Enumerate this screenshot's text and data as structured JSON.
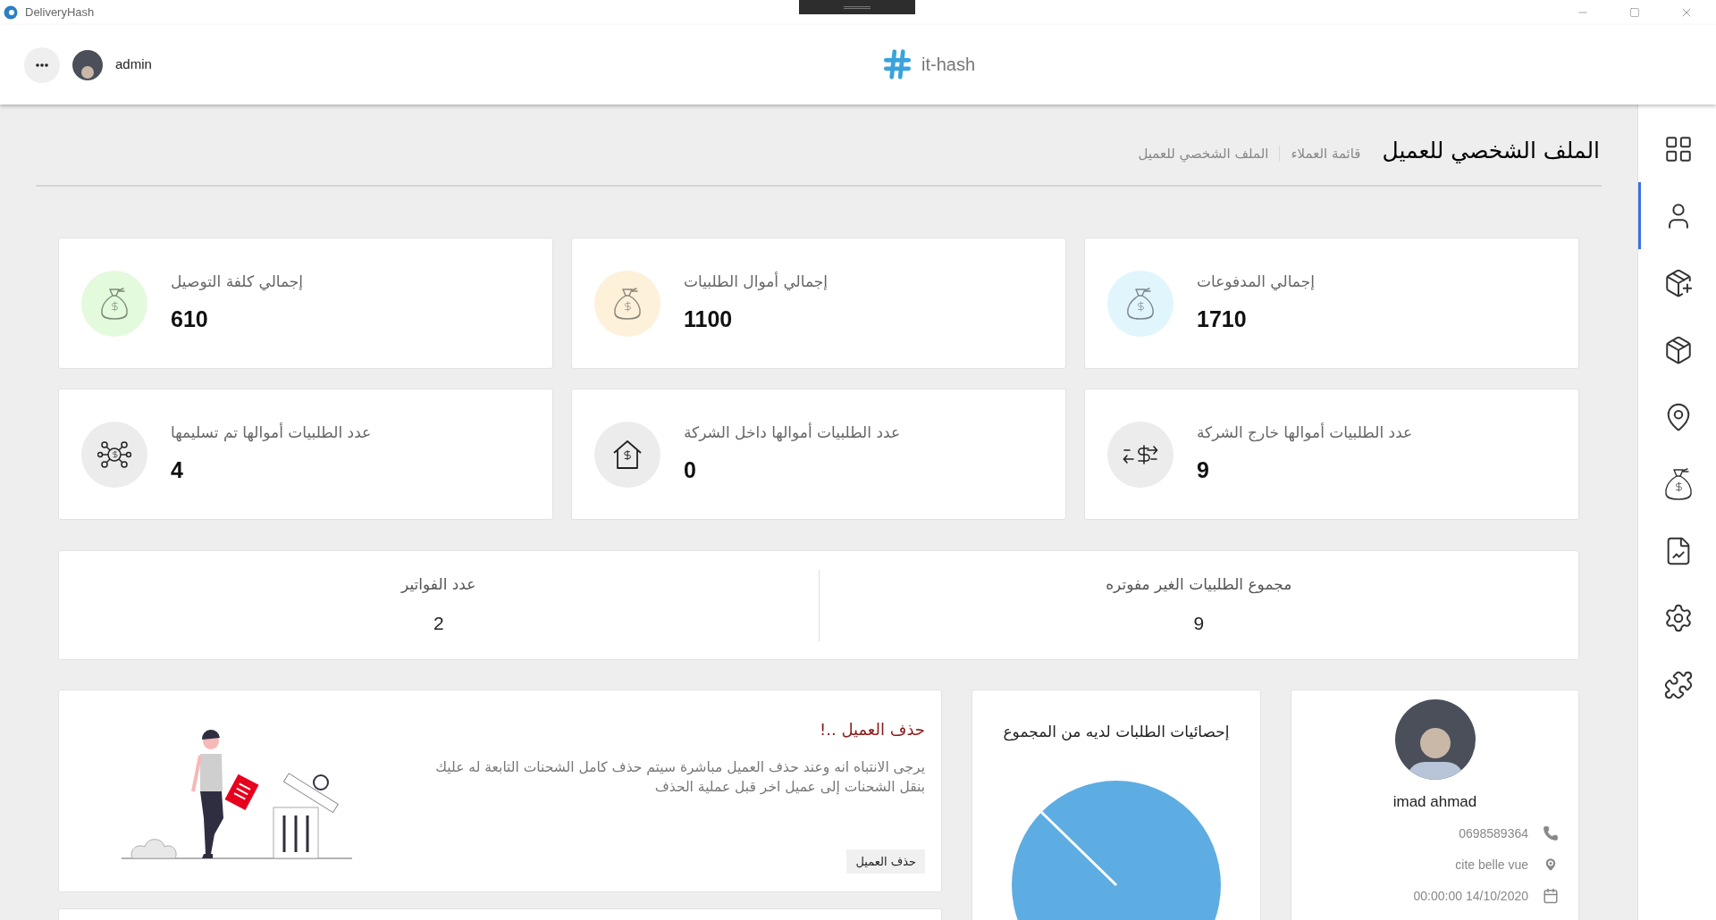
{
  "window": {
    "title": "DeliveryHash"
  },
  "header": {
    "user": "admin",
    "brand": "it-hash"
  },
  "page": {
    "title": "الملف الشخصي للعميل",
    "breadcrumb": [
      "قائمة العملاء",
      "الملف الشخصي للعميل"
    ]
  },
  "stats": [
    {
      "label": "إجمالي المدفوعات",
      "value": "1710",
      "kind": "bag",
      "color": "#e1f5fd"
    },
    {
      "label": "إجمالي أموال الطلبيات",
      "value": "1100",
      "kind": "bag",
      "color": "#fdf1da"
    },
    {
      "label": "إجمالي كلفة التوصيل",
      "value": "610",
      "kind": "bag",
      "color": "#e3fadc"
    },
    {
      "label": "عدد الطلبيات أموالها خارج الشركة",
      "value": "9",
      "kind": "exchange",
      "color": "#ececec"
    },
    {
      "label": "عدد الطلبيات أموالها داخل الشركة",
      "value": "0",
      "kind": "house",
      "color": "#ececec"
    },
    {
      "label": "عدد الطلبيات أموالها تم تسليمها",
      "value": "4",
      "kind": "network",
      "color": "#ececec"
    }
  ],
  "summary": [
    {
      "label": "مجموع الطلبيات الغير مفوتره",
      "value": "9"
    },
    {
      "label": "عدد الفواتير",
      "value": "2"
    }
  ],
  "profile": {
    "name": "imad ahmad",
    "details": [
      {
        "kind": "phone",
        "text": "0698589364"
      },
      {
        "kind": "location",
        "text": "cite belle vue"
      },
      {
        "kind": "date",
        "text": "00:00:00 14/10/2020"
      }
    ]
  },
  "chart_panel": {
    "title": "إحصائيات الطلبات لديه من المجموع"
  },
  "delete_panel": {
    "title": "حذف العميل ..!",
    "message": "يرجى الانتباه انه وعند حذف العميل مباشرة سيتم حذف كامل الشحنات التابعة له عليك بنقل الشحنات إلى عميل اخر قبل عملية الحذف",
    "button": "حذف العميل"
  },
  "sidebar": {
    "items": [
      {
        "kind": "dashboard",
        "selected": false
      },
      {
        "kind": "user",
        "selected": true
      },
      {
        "kind": "add-package",
        "selected": false
      },
      {
        "kind": "global-package",
        "selected": false
      },
      {
        "kind": "location",
        "selected": false
      },
      {
        "kind": "money",
        "selected": false
      },
      {
        "kind": "report",
        "selected": false
      },
      {
        "kind": "settings",
        "selected": false
      },
      {
        "kind": "plugins",
        "selected": false
      }
    ]
  }
}
